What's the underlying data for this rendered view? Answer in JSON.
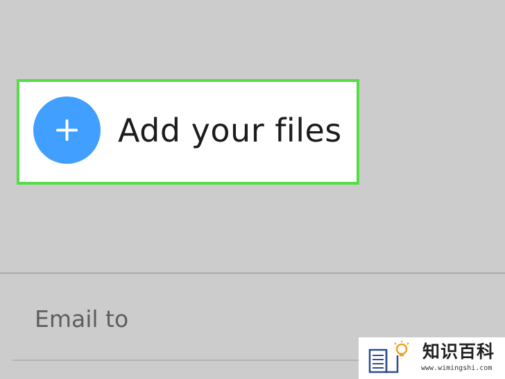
{
  "upload": {
    "add_files_label": "Add your files",
    "icon": "plus-icon",
    "accent_color": "#409fff",
    "highlight_color": "#55dd44"
  },
  "form": {
    "email_to_placeholder": "Email to"
  },
  "watermark": {
    "title": "知识百科",
    "url": "www.wimingshi.com",
    "icon": "book-lightbulb-icon"
  }
}
